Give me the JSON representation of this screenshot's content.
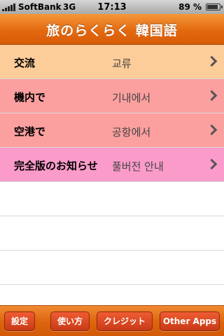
{
  "status_bar": {
    "carrier": "SoftBank",
    "network": "3G",
    "time": "17:13",
    "battery_percent": "89 %",
    "battery_level": 0.89
  },
  "nav": {
    "title": "旅のらくらく 韓国語"
  },
  "menu_rows": [
    {
      "jp": "交流",
      "ko": "교류",
      "color": "#fccc99"
    },
    {
      "jp": "機内で",
      "ko": "기내에서",
      "color": "#fc9f9f"
    },
    {
      "jp": "空港で",
      "ko": "공항에서",
      "color": "#fc9f9f"
    },
    {
      "jp": "完全版のお知らせ",
      "ko": "풀버전 안내",
      "color": "#fb9bca"
    }
  ],
  "toolbar": {
    "settings_label": "設定",
    "howto_label": "使い方",
    "credit_label": "クレジット",
    "other_apps_label": "Other Apps"
  },
  "colors": {
    "nav_bar": "#e3690f",
    "toolbar_button": "#dd4a22"
  }
}
